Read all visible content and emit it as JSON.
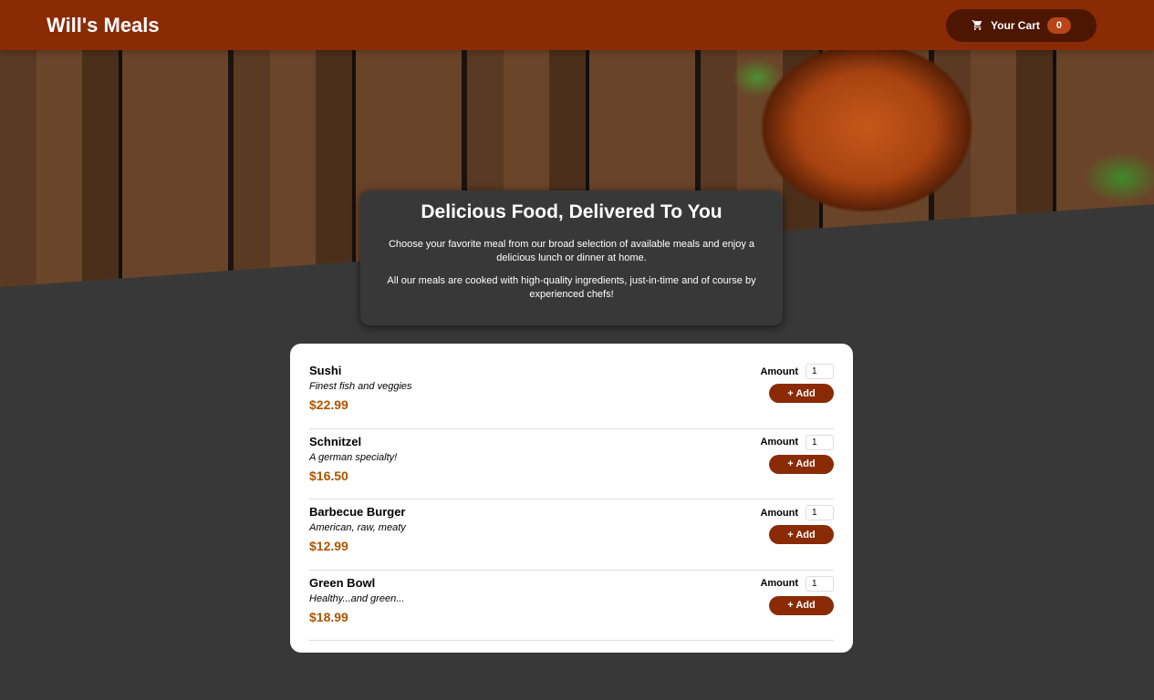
{
  "header": {
    "title": "Will's Meals",
    "cart_label": "Your Cart",
    "cart_count": "0",
    "cart_icon": "cart-icon"
  },
  "summary": {
    "title": "Delicious Food, Delivered To You",
    "p1": "Choose your favorite meal from our broad selection of available meals and enjoy a delicious lunch or dinner at home.",
    "p2": "All our meals are cooked with high-quality ingredients, just-in-time and of course by experienced chefs!"
  },
  "meals": [
    {
      "name": "Sushi",
      "description": "Finest fish and veggies",
      "price": "$22.99",
      "amount": "1"
    },
    {
      "name": "Schnitzel",
      "description": "A german specialty!",
      "price": "$16.50",
      "amount": "1"
    },
    {
      "name": "Barbecue Burger",
      "description": "American, raw, meaty",
      "price": "$12.99",
      "amount": "1"
    },
    {
      "name": "Green Bowl",
      "description": "Healthy...and green...",
      "price": "$18.99",
      "amount": "1"
    }
  ],
  "labels": {
    "amount": "Amount",
    "add": "+ Add"
  },
  "colors": {
    "header": "#8a2b06",
    "cart_button": "#4d1601",
    "badge": "#b94517",
    "price": "#ad5502"
  }
}
